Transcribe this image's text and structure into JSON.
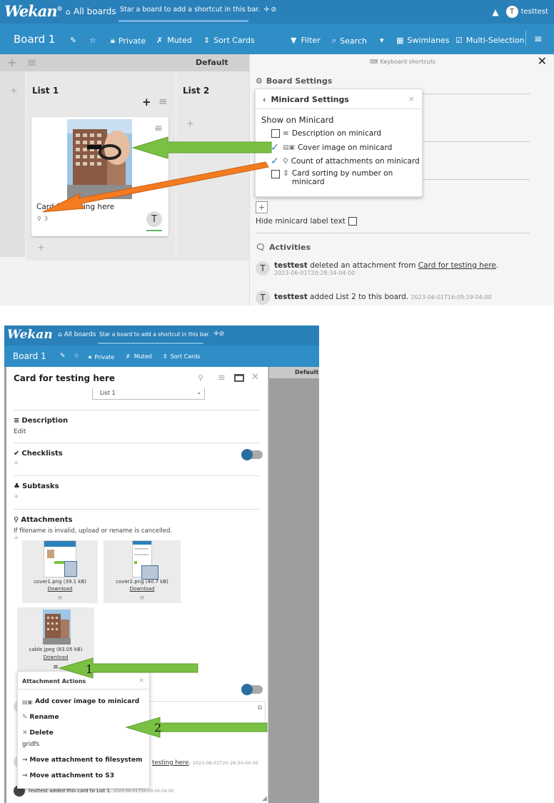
{
  "top": {
    "header": {
      "logo": "Wekan",
      "logo_mark": "®",
      "all_boards": "All boards",
      "star_hint": "Star a board to add a shortcut in this bar.",
      "username": "testtest",
      "avatar_initial": "T"
    },
    "board_bar": {
      "title": "Board 1",
      "private": "Private",
      "muted": "Muted",
      "sort_cards": "Sort Cards",
      "filter": "Filter",
      "search": "Search",
      "swimlanes": "Swimlanes",
      "multi_selection": "Multi-Selection"
    },
    "swimlane": {
      "name": "Default"
    },
    "lists": [
      {
        "title": "List 1"
      },
      {
        "title": "List 2"
      }
    ],
    "card": {
      "title": "Card for testing here",
      "attachment_count": "3",
      "member_initial": "T"
    },
    "sidebar": {
      "keyboard_shortcuts": "Keyboard shortcuts",
      "board_settings": "Board Settings",
      "hide_label_text": "Hide minicard label text",
      "activities": "Activities",
      "activity_1": {
        "user": "testtest",
        "text": "deleted an attachment from",
        "link": "Card for testing here",
        "time": "2023-06-01T20:28:34-04:00"
      },
      "activity_2": {
        "user": "testtest",
        "text": "added List 2 to this board.",
        "time": "2023-06-01T16:09:19-04:00"
      }
    },
    "minicard_popup": {
      "title": "Minicard Settings",
      "show_on_minicard": "Show on Minicard",
      "options": [
        {
          "label": "Description on minicard",
          "checked": false
        },
        {
          "label": "Cover image on minicard",
          "checked": true
        },
        {
          "label": "Count of attachments on minicard",
          "checked": true
        },
        {
          "label": "Card sorting by number on minicard",
          "checked": false
        }
      ]
    }
  },
  "bottom": {
    "header": {
      "logo": "Wekan",
      "all_boards": "All boards",
      "star_hint": "Star a board to add a shortcut in this bar."
    },
    "board_bar": {
      "title": "Board 1",
      "private": "Private",
      "muted": "Muted",
      "sort_cards": "Sort Cards",
      "swimlane_default": "Default"
    },
    "card_detail": {
      "title": "Card for testing here",
      "list_select": "List 1",
      "description": "Description",
      "description_edit": "Edit",
      "checklists": "Checklists",
      "subtasks": "Subtasks",
      "attachments": "Attachments",
      "attachments_note": "If filename is invalid, upload or rename is cancelled.",
      "files": [
        {
          "name": "cover1.png (39.1 kB)",
          "download": "Download"
        },
        {
          "name": "cover2.png (40.7 kB)",
          "download": "Download"
        },
        {
          "name": "cable.jpeg (83.05 kB)",
          "download": "Download"
        }
      ],
      "activity_link": "testing here",
      "activity_time": "2023-06-01T20:28:34-04:00",
      "activity_bottom": "testtest added this card to List 1.",
      "activity_bottom_time": "2023-06-01T16:09:06-04:00"
    },
    "attachment_actions": {
      "title": "Attachment Actions",
      "add_cover": "Add cover image to minicard",
      "rename": "Rename",
      "delete": "Delete",
      "storage": "gridfs",
      "move_fs": "Move attachment to filesystem",
      "move_s3": "Move attachment to S3"
    },
    "annotations": {
      "step1": "1",
      "step2": "2"
    }
  },
  "colors": {
    "header": "#2a80b9",
    "board_bar": "#2f8ec6",
    "arrow_green": "#7ac143",
    "arrow_orange": "#f47b20",
    "check_blue": "#2a80b9"
  }
}
